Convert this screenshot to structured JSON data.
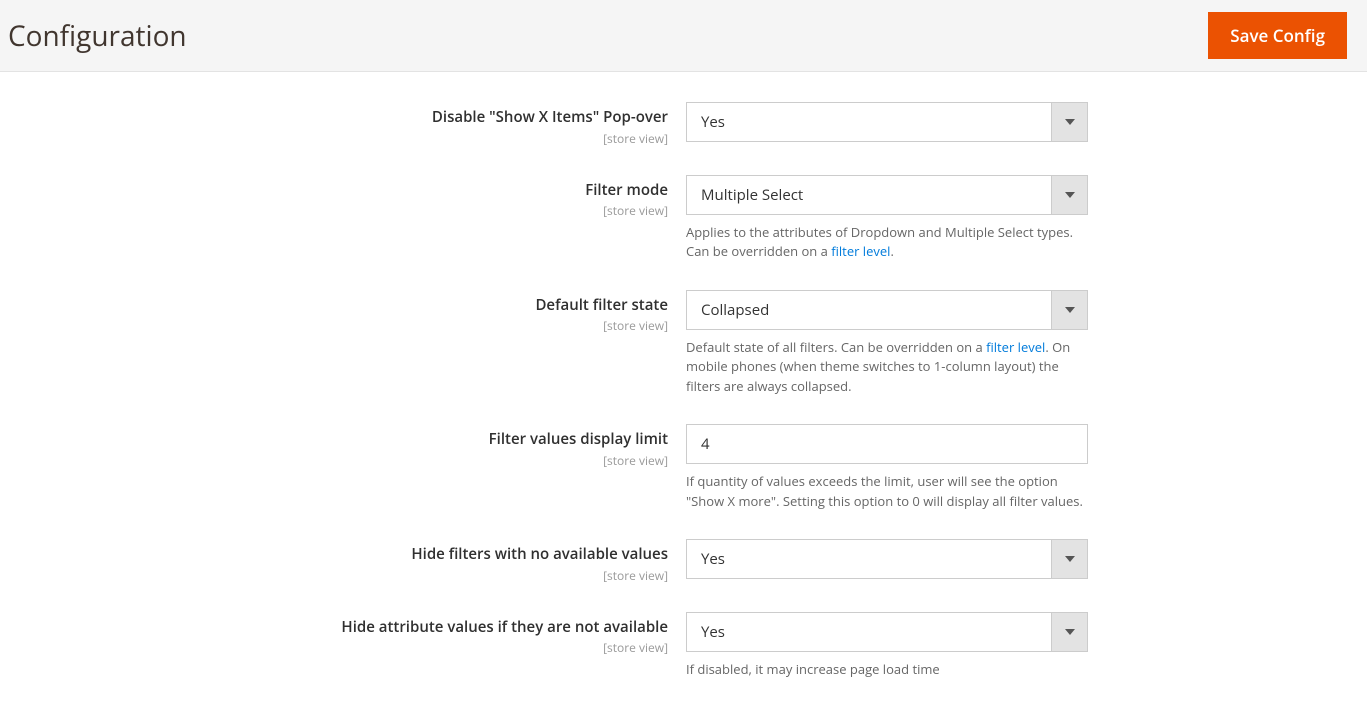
{
  "header": {
    "title": "Configuration",
    "save_label": "Save Config"
  },
  "scope_label": "[store view]",
  "fields": {
    "disable_popover": {
      "label": "Disable \"Show X Items\" Pop-over",
      "value": "Yes"
    },
    "filter_mode": {
      "label": "Filter mode",
      "value": "Multiple Select",
      "note_pre": "Applies to the attributes of Dropdown and Multiple Select types. Can be overridden on a ",
      "note_link": "filter level",
      "note_post": "."
    },
    "default_state": {
      "label": "Default filter state",
      "value": "Collapsed",
      "note_pre": "Default state of all filters. Can be overridden on a ",
      "note_link": "filter level",
      "note_post": ". On mobile phones (when theme switches to 1-column layout) the filters are always collapsed."
    },
    "display_limit": {
      "label": "Filter values display limit",
      "value": "4",
      "note": "If quantity of values exceeds the limit, user will see the option \"Show X more\". Setting this option to 0 will display all filter values."
    },
    "hide_empty": {
      "label": "Hide filters with no available values",
      "value": "Yes"
    },
    "hide_unavailable_values": {
      "label": "Hide attribute values if they are not available",
      "value": "Yes",
      "note": "If disabled, it may increase page load time"
    }
  }
}
